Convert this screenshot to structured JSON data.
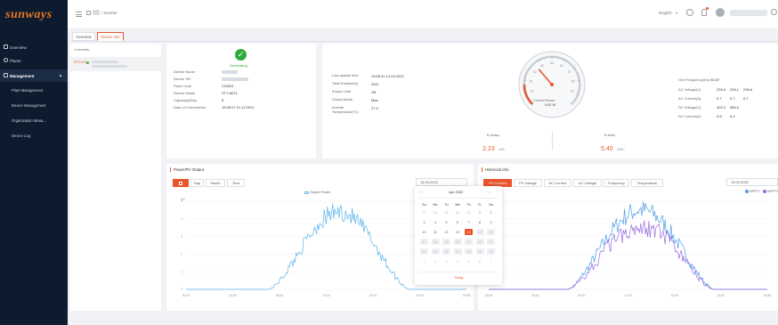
{
  "brand": {
    "logo": "sunways",
    "accent": "#e8542b",
    "navy": "#0d1b2e"
  },
  "sidebar": {
    "items": [
      {
        "label": "Overview",
        "icon": "monitor-icon"
      },
      {
        "label": "Plants",
        "icon": "plant-icon"
      },
      {
        "label": "Management",
        "icon": "management-icon"
      }
    ],
    "subitems": [
      "Plant Management",
      "Device Management",
      "Organization Mana...",
      "Device Log"
    ]
  },
  "topbar": {
    "breadcrumb": "/ Inverter",
    "language": "English"
  },
  "tabs": [
    "Overview",
    "Device Info"
  ],
  "tree": {
    "root": "Inverter",
    "item": "STS KS"
  },
  "device": {
    "status": "Generating",
    "fields": [
      {
        "label": "Device Name",
        "value": ""
      },
      {
        "label": "Device SN",
        "value": ""
      },
      {
        "label": "Plant Code",
        "value": "210024"
      },
      {
        "label": "Device Model",
        "value": "STT-8KTL"
      },
      {
        "label": "Capacity(kWp)",
        "value": "8"
      },
      {
        "label": "Date of Commission",
        "value": "19:08:27 21.12.2021"
      }
    ]
  },
  "realtime": {
    "fields": [
      {
        "label": "Last update time",
        "value": "19:05:41 14.04.2022"
      },
      {
        "label": "Total Runtime(h)",
        "value": "2911"
      },
      {
        "label": "Export Limit",
        "value": "Off"
      },
      {
        "label": "Output Mode",
        "value": "Max"
      },
      {
        "label": "Inverter Temperature(°C)",
        "value": "27.4"
      }
    ],
    "gauge_label": "Current Power",
    "gauge_value": "0.00 W",
    "gauge_fraction": 0.35,
    "gauge_ticks": [
      "10",
      "20",
      "30",
      "40",
      "50",
      "60",
      "70",
      "80",
      "90"
    ],
    "etoday_label": "E-today",
    "etoday_value": "2.23",
    "etoday_unit": "kWh",
    "etotal_label": "E-total",
    "etotal_value": "5.40",
    "etotal_unit": "MWh"
  },
  "grid": {
    "frequency_label": "Grid Frequency(Hz)",
    "frequency_value": "50.07",
    "rows": [
      {
        "label": "AC Voltage(V)",
        "values": [
          "236.6",
          "236.1",
          "236.6"
        ]
      },
      {
        "label": "AC Current(A)",
        "values": [
          "0.7",
          "0.7",
          "0.7"
        ]
      },
      {
        "label": "DC Voltage(V)",
        "values": [
          "402.3",
          "384.5",
          ""
        ]
      },
      {
        "label": "DC Current(A)",
        "values": [
          "0.8",
          "0.4",
          ""
        ]
      }
    ]
  },
  "power_chart": {
    "title": "Power/PV Output",
    "periods": [
      "Day",
      "Month",
      "Year"
    ],
    "active_period": "Day",
    "date": "14.04.2022",
    "legend": "Output Power",
    "y_unit": "kW",
    "y_ticks": [
      "0",
      "1",
      "2",
      "3",
      "4",
      "5"
    ],
    "x_ticks": [
      "00:00",
      "04:00",
      "08:00",
      "12:00",
      "16:00",
      "20:00",
      "23:55"
    ],
    "color": "#5ab4ea"
  },
  "calendar": {
    "month": "Apr",
    "year": "2022",
    "weekdays": [
      "Su",
      "Mo",
      "Tu",
      "We",
      "Th",
      "Fr",
      "Sa"
    ],
    "days": [
      [
        "27",
        "28",
        "29",
        "30",
        "31",
        "1",
        "2"
      ],
      [
        "3",
        "4",
        "5",
        "6",
        "7",
        "8",
        "9"
      ],
      [
        "10",
        "11",
        "12",
        "13",
        "14",
        "15",
        "16"
      ],
      [
        "17",
        "18",
        "19",
        "20",
        "21",
        "22",
        "23"
      ],
      [
        "24",
        "25",
        "26",
        "27",
        "28",
        "29",
        "30"
      ],
      [
        "1",
        "2",
        "3",
        "4",
        "5",
        "6",
        "7"
      ]
    ],
    "selected": "14",
    "today_label": "Today"
  },
  "historical": {
    "title": "Historical Info",
    "tabs": [
      "PV Current",
      "PV Voltage",
      "AC Current",
      "AC Voltage",
      "Frequency",
      "Temperature"
    ],
    "date": "14.04.2022",
    "series": [
      {
        "name": "MPPT1",
        "color": "#4a9ee6"
      },
      {
        "name": "MPPT2",
        "color": "#9b6bdf"
      }
    ],
    "x_ticks": [
      "00:00",
      "04:00",
      "08:00",
      "12:00",
      "16:00",
      "20:00",
      "23:55"
    ]
  }
}
